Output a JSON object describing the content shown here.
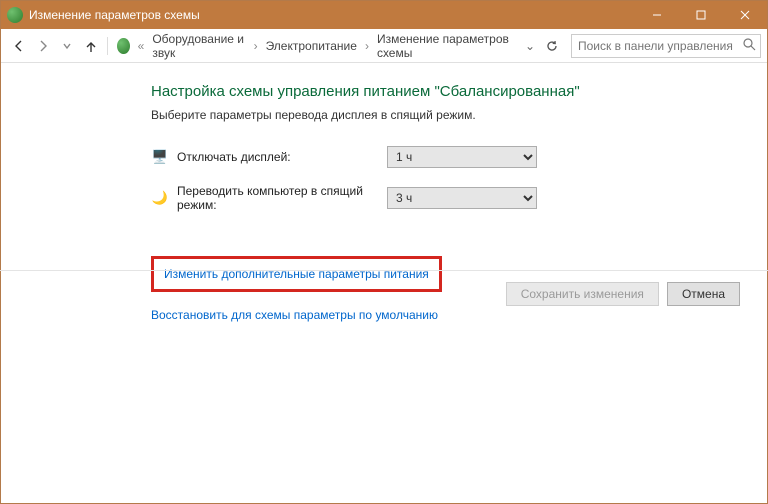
{
  "window": {
    "title": "Изменение параметров схемы"
  },
  "breadcrumb": {
    "items": [
      "Оборудование и звук",
      "Электропитание",
      "Изменение параметров схемы"
    ]
  },
  "search": {
    "placeholder": "Поиск в панели управления"
  },
  "page": {
    "heading": "Настройка схемы управления питанием \"Сбалансированная\"",
    "subtext": "Выберите параметры перевода дисплея в спящий режим."
  },
  "settings": {
    "display_off": {
      "label": "Отключать дисплей:",
      "value": "1 ч"
    },
    "sleep": {
      "label": "Переводить компьютер в спящий режим:",
      "value": "3 ч"
    }
  },
  "links": {
    "advanced": "Изменить дополнительные параметры питания",
    "restore": "Восстановить для схемы параметры по умолчанию"
  },
  "buttons": {
    "save": "Сохранить изменения",
    "cancel": "Отмена"
  }
}
